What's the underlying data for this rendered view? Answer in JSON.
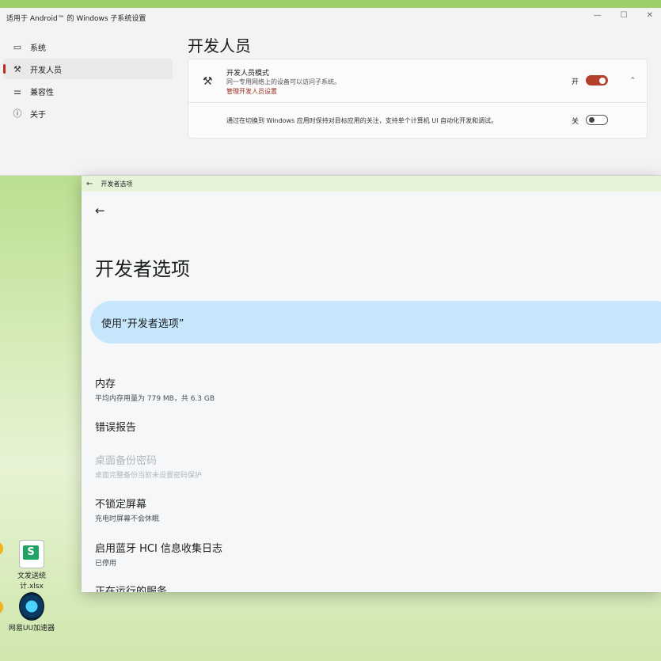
{
  "settings_window": {
    "title": "适用于 Android™ 的 Windows 子系统设置",
    "controls": {
      "minimize": "—",
      "maximize": "☐",
      "close": "✕"
    },
    "nav": [
      {
        "label": "系统",
        "icon": "monitor-icon"
      },
      {
        "label": "开发人员",
        "icon": "tools-icon",
        "active": true
      },
      {
        "label": "兼容性",
        "icon": "sliders-icon"
      },
      {
        "label": "关于",
        "icon": "info-icon"
      }
    ],
    "page_title": "开发人员",
    "dev_mode": {
      "title": "开发人员模式",
      "description": "同一专用网络上的设备可以访问子系统。",
      "link": "管理开发人员设置",
      "state_label": "开",
      "on": true
    },
    "focus_setting": {
      "description": "通过在切换到 Windows 应用时保持对目标应用的关注，支持单个计算机 UI 自动化开发和调试。",
      "state_label": "关",
      "on": false
    }
  },
  "android_window": {
    "titlebar": "开发者选项",
    "page_title": "开发者选项",
    "master_switch_label": "使用“开发者选项”",
    "prefs": [
      {
        "title": "内存",
        "summary": "平均内存用量为 779 MB，共 6.3 GB"
      },
      {
        "title": "错误报告",
        "summary": ""
      },
      {
        "title": "桌面备份密码",
        "summary": "桌面完整备份当前未设置密码保护",
        "disabled": true
      },
      {
        "title": "不锁定屏幕",
        "summary": "充电时屏幕不会休眠"
      },
      {
        "title": "启用蓝牙 HCI 信息收集日志",
        "summary": "已停用"
      },
      {
        "title": "正在运行的服务",
        "summary": ""
      }
    ]
  },
  "desktop_icons": [
    {
      "label": "文发送统计.xlsx",
      "icon": "xlsx-icon"
    },
    {
      "label": "网易UU加速器",
      "icon": "uu-accelerator-icon"
    }
  ]
}
